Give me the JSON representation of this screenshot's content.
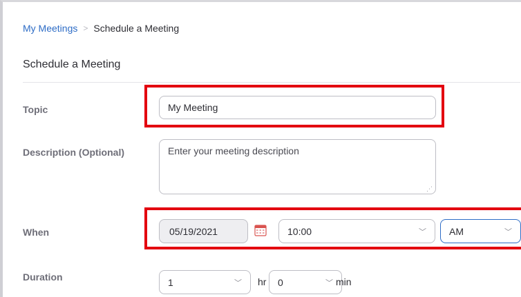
{
  "breadcrumb": {
    "parent": "My Meetings",
    "separator": ">",
    "current": "Schedule a Meeting"
  },
  "page_title": "Schedule a Meeting",
  "form": {
    "topic": {
      "label": "Topic",
      "value": "My Meeting"
    },
    "description": {
      "label": "Description (Optional)",
      "placeholder": "Enter your meeting description",
      "value": ""
    },
    "when": {
      "label": "When",
      "date": "05/19/2021",
      "time": "10:00",
      "ampm": "AM"
    },
    "duration": {
      "label": "Duration",
      "hours": "1",
      "hours_unit": "hr",
      "minutes": "0",
      "minutes_unit": "min"
    }
  },
  "icons": {
    "calendar": "calendar-icon",
    "dropdown": "chevron-down-icon"
  },
  "colors": {
    "link": "#2d6cc6",
    "highlight": "#e3000f",
    "label": "#6e6e78",
    "focus_border": "#2d6cc6"
  }
}
